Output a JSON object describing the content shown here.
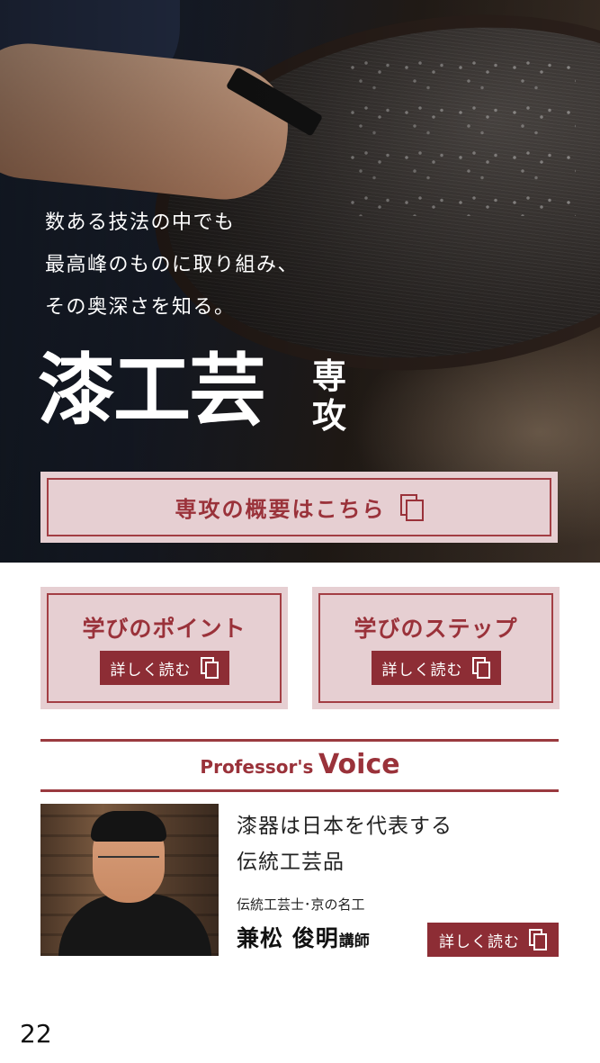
{
  "hero": {
    "lead_lines": [
      "数ある技法の中でも",
      "最高峰のものに取り組み、",
      "その奥深さを知る。"
    ],
    "title": "漆工芸",
    "subtitle_chars": [
      "専",
      "攻"
    ],
    "overview_button": "専攻の概要はこちら",
    "photo_alt": "漆塗りの作業風景"
  },
  "cards": [
    {
      "title": "学びのポイント",
      "button": "詳しく読む"
    },
    {
      "title": "学びのステップ",
      "button": "詳しく読む"
    }
  ],
  "voice": {
    "title_prefix": "Professor's",
    "title_main": "Voice",
    "quote_lines": [
      "漆器は日本を代表する",
      "伝統工芸品"
    ],
    "role": "伝統工芸士･京の名工",
    "name": "兼松 俊明",
    "name_suffix": "講師",
    "read_more": "詳しく読む"
  },
  "page_number": "22",
  "colors": {
    "accent": "#9a323a",
    "accent_dark": "#8d2d35",
    "card_bg": "#e6cfd2"
  },
  "icons": {
    "copy": "copy-icon"
  }
}
